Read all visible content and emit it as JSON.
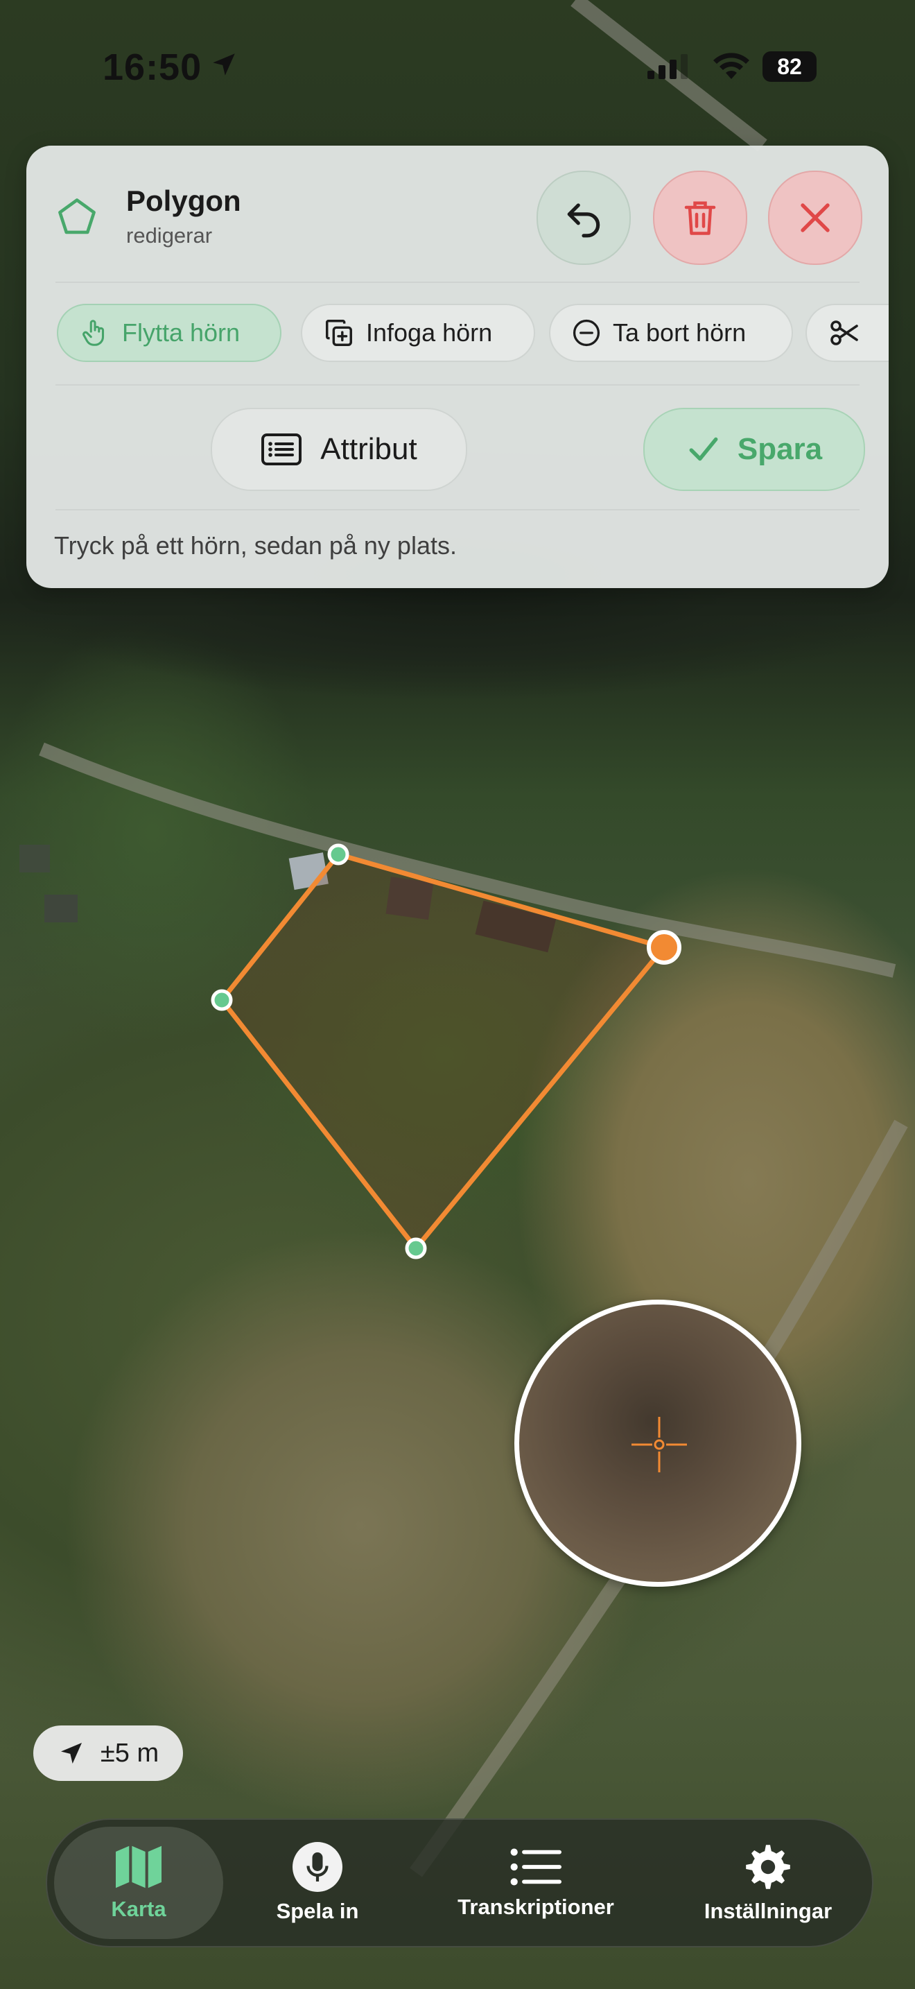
{
  "status_bar": {
    "time": "16:50",
    "battery": "82"
  },
  "panel": {
    "title": "Polygon",
    "subtitle": "redigerar",
    "chips": {
      "move_vertex": "Flytta hörn",
      "insert_vertex": "Infoga hörn",
      "remove_vertex": "Ta bort hörn"
    },
    "attributes_label": "Attribut",
    "save_label": "Spara",
    "hint": "Tryck på ett hörn, sedan på ny plats."
  },
  "accuracy": {
    "label": "±5 m"
  },
  "tabbar": {
    "tabs": [
      {
        "label": "Karta",
        "icon": "map-icon",
        "active": true
      },
      {
        "label": "Spela in",
        "icon": "microphone-icon"
      },
      {
        "label": "Transkriptioner",
        "icon": "list-icon"
      },
      {
        "label": "Inställningar",
        "icon": "gear-icon"
      }
    ]
  },
  "colors": {
    "accent_green": "#48a86b",
    "polygon_stroke": "#f28a33",
    "vertex_fill": "#66c98f",
    "danger_red": "#e04848"
  }
}
